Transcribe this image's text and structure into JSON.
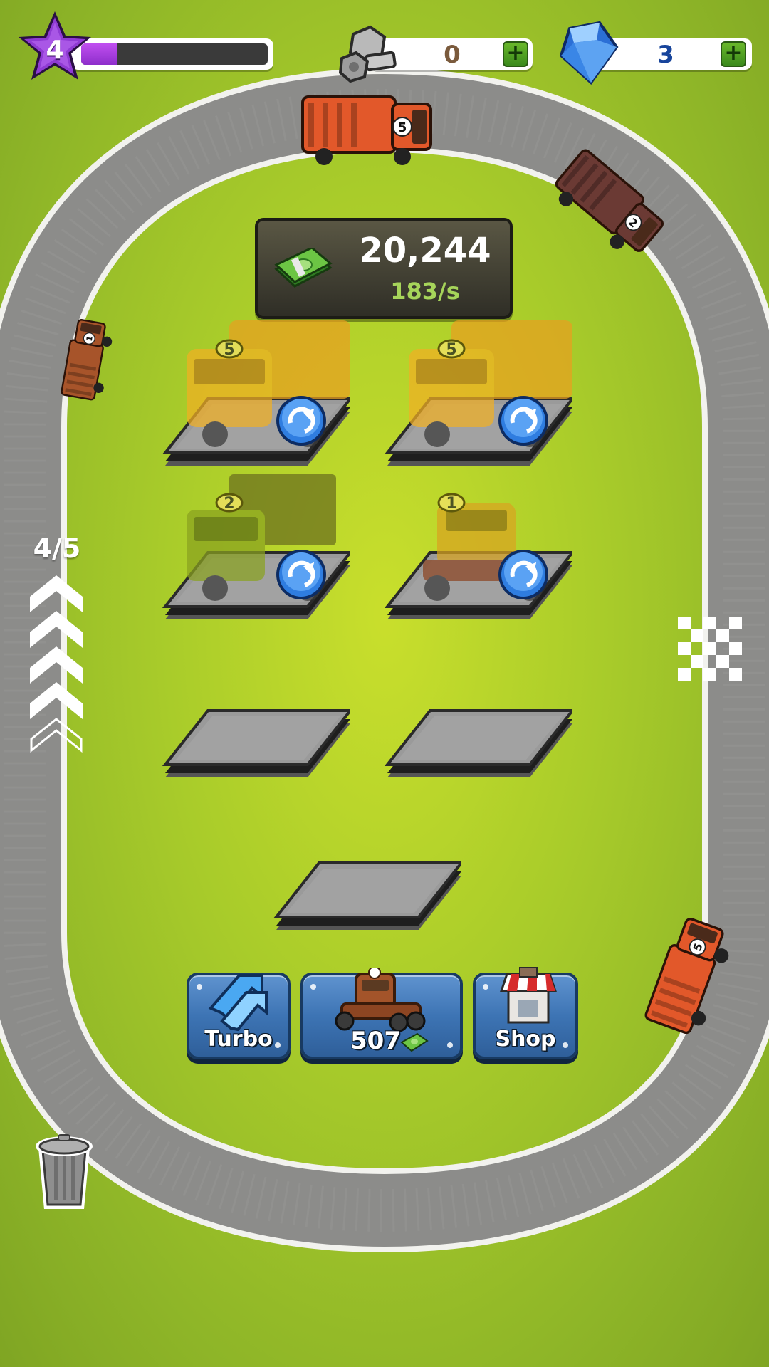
{
  "player": {
    "level": "4",
    "xp_progress": 0.19
  },
  "resources": {
    "bolts": {
      "icon": "bolt-nut-icon",
      "value": "0"
    },
    "gems": {
      "icon": "gem-icon",
      "value": "3"
    }
  },
  "money": {
    "icon": "cash-icon",
    "amount": "20,244",
    "rate": "183/s"
  },
  "garage": {
    "pads": [
      {
        "occupied": true,
        "truck_number": "5",
        "truck_type": "garbage-truck"
      },
      {
        "occupied": true,
        "truck_number": "5",
        "truck_type": "garbage-truck"
      },
      {
        "occupied": true,
        "truck_number": "2",
        "truck_type": "box-truck"
      },
      {
        "occupied": true,
        "truck_number": "1",
        "truck_type": "semi-cab"
      },
      {
        "occupied": false
      },
      {
        "occupied": false
      },
      {
        "occupied": false
      }
    ]
  },
  "track": {
    "lap_progress": "4/5",
    "trucks": [
      {
        "number": "5",
        "color": "#e2582a"
      },
      {
        "number": "2",
        "color": "#6b3a34"
      },
      {
        "number": "1",
        "color": "#a7542a"
      },
      {
        "number": "5",
        "color": "#e2582a"
      }
    ]
  },
  "buttons": {
    "turbo": {
      "label": "Turbo",
      "icon": "turbo-arrow-icon"
    },
    "buy_truck": {
      "price": "507",
      "icon": "truck-icon"
    },
    "shop": {
      "label": "Shop",
      "icon": "shop-icon"
    }
  },
  "colors": {
    "grass": "#a9cc2a",
    "road": "#8a8a88",
    "button_blue": "#3d74b4",
    "xp_purple": "#a13fe0",
    "bolt_count": "#7a5a3c",
    "gem_count": "#17449b"
  }
}
